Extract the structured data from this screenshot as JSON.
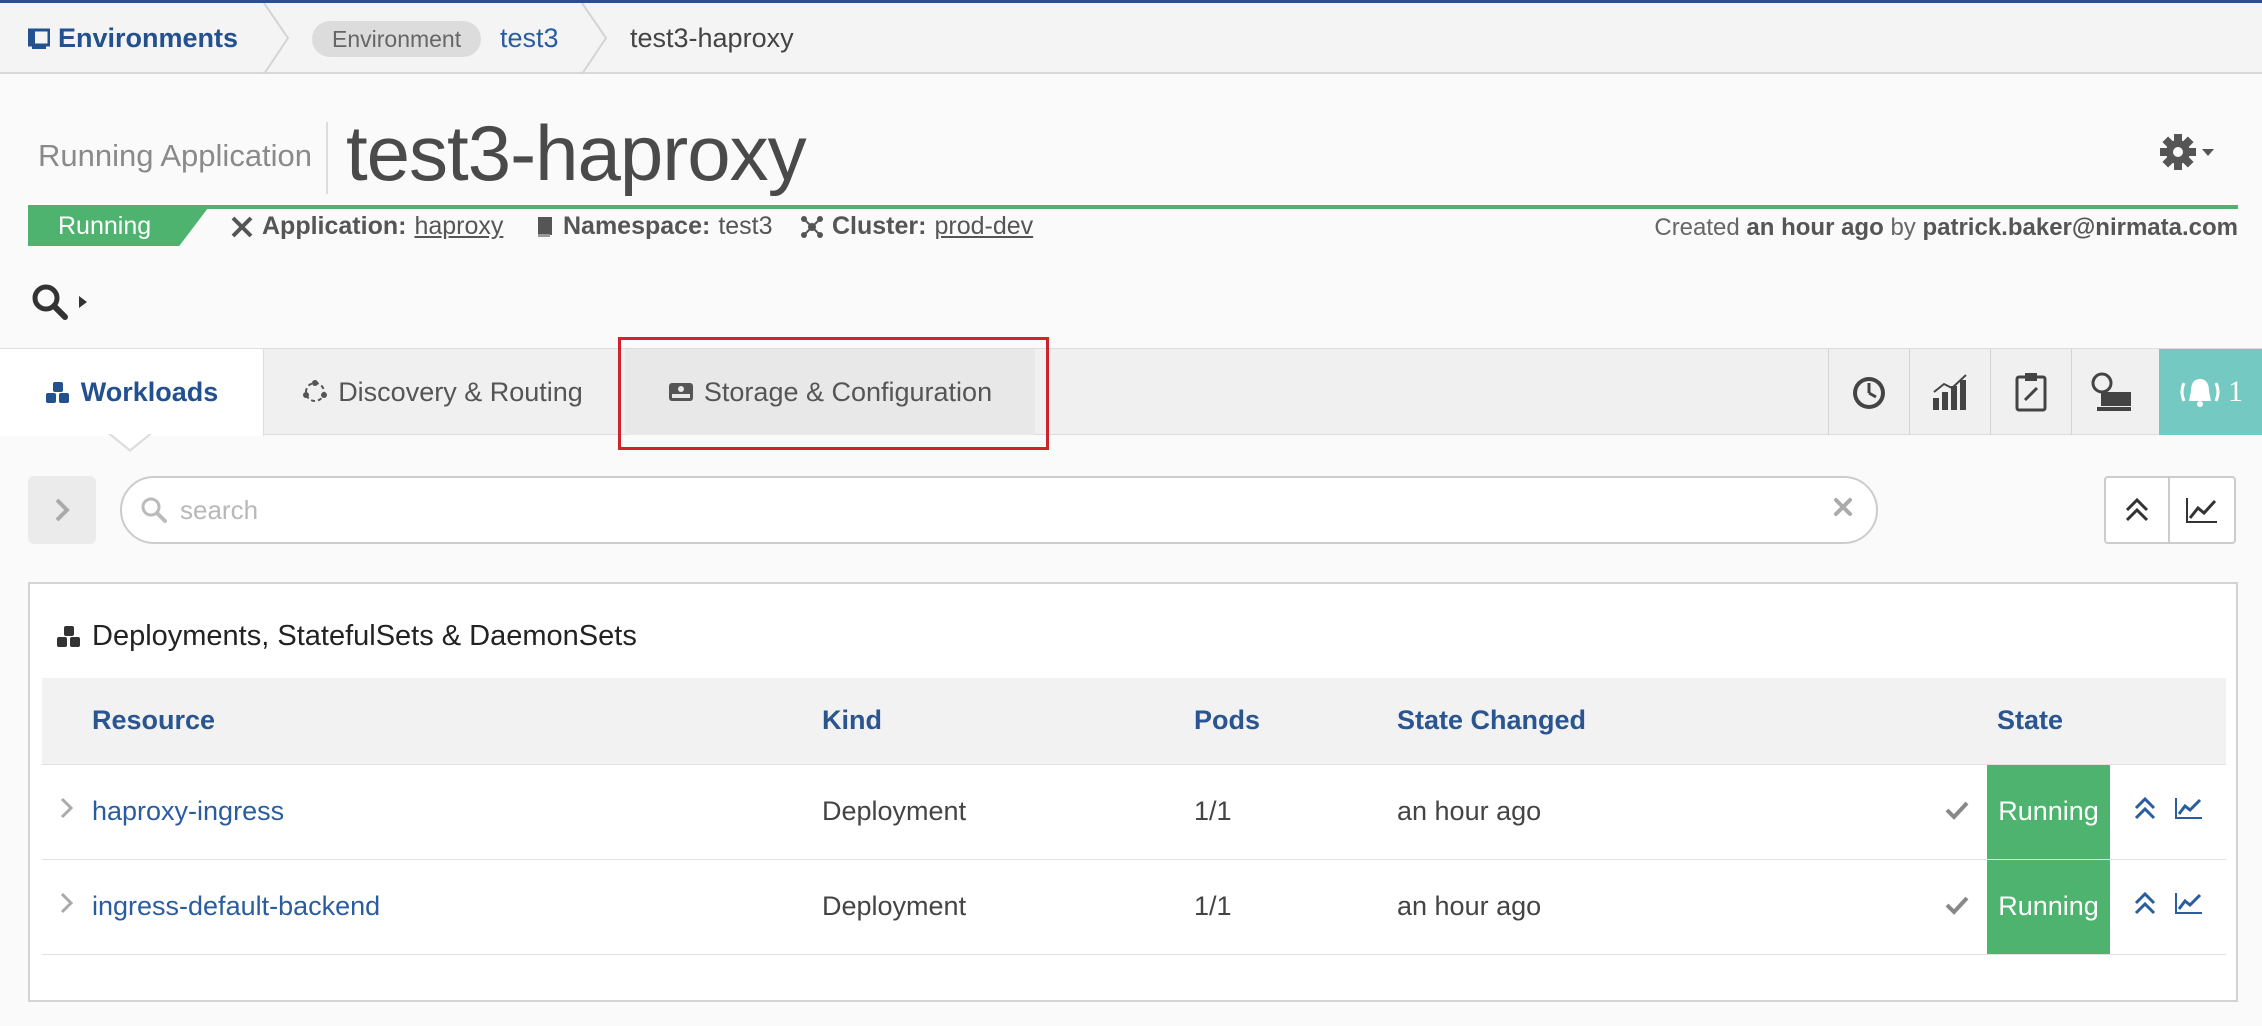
{
  "breadcrumb": {
    "root": "Environments",
    "env_badge": "Environment",
    "env_name": "test3",
    "current": "test3-haproxy"
  },
  "header": {
    "label": "Running Application",
    "title": "test3-haproxy",
    "status": "Running",
    "application_label": "Application:",
    "application_value": "haproxy",
    "namespace_label": "Namespace:",
    "namespace_value": "test3",
    "cluster_label": "Cluster:",
    "cluster_value": "prod-dev",
    "created_prefix": "Created",
    "created_when": "an hour ago",
    "created_by_word": "by",
    "created_by": "patrick.baker@nirmata.com"
  },
  "tabs": [
    {
      "label": "Workloads",
      "icon": "cubes-icon",
      "active": true
    },
    {
      "label": "Discovery & Routing",
      "icon": "network-icon",
      "active": false
    },
    {
      "label": "Storage & Configuration",
      "icon": "hard-drive-icon",
      "active": false
    }
  ],
  "icon_tabs": [
    "history-icon",
    "bar-chart-icon",
    "clipboard-icon",
    "monitor-icon"
  ],
  "alarm": {
    "icon": "bell-alert-icon",
    "count": "1"
  },
  "filter": {
    "placeholder": "search",
    "value": ""
  },
  "panel": {
    "title": "Deployments, StatefulSets & DaemonSets",
    "columns": [
      "Resource",
      "Kind",
      "Pods",
      "State Changed",
      "State"
    ],
    "rows": [
      {
        "resource": "haproxy-ingress",
        "kind": "Deployment",
        "pods": "1/1",
        "changed": "an hour ago",
        "state": "Running"
      },
      {
        "resource": "ingress-default-backend",
        "kind": "Deployment",
        "pods": "1/1",
        "changed": "an hour ago",
        "state": "Running"
      }
    ]
  },
  "colors": {
    "brand": "#23508f",
    "running": "#4db36e",
    "alarm": "#74c9c2",
    "highlight": "#d0242b"
  }
}
